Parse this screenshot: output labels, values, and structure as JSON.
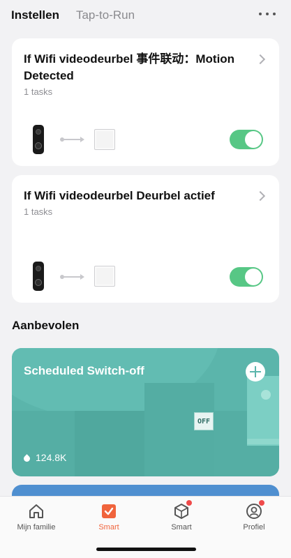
{
  "header": {
    "tabs": [
      {
        "label": "Instellen",
        "active": true
      },
      {
        "label": "Tap-to-Run",
        "active": false
      }
    ],
    "more_icon": "more-horizontal-icon"
  },
  "automations": [
    {
      "title": "If Wifi videodeurbel  事件联动：Motion Detected",
      "tasks": "1 tasks",
      "enabled": true
    },
    {
      "title": "If Wifi videodeurbel  Deurbel actief",
      "tasks": "1 tasks",
      "enabled": true
    }
  ],
  "recommended": {
    "section_title": "Aanbevolen",
    "cards": [
      {
        "title": "Scheduled Switch-off",
        "count": "124.8K",
        "badge_text": "OFF"
      }
    ]
  },
  "colors": {
    "toggle_on": "#57c785",
    "accent": "#f0643c",
    "recommend_card": "#5bb5ab",
    "recommend_card_2": "#4f8fd0"
  },
  "tabbar": {
    "items": [
      {
        "label": "Mijn familie",
        "icon": "home-icon",
        "active": false
      },
      {
        "label": "Smart",
        "icon": "smart-check-icon",
        "active": true
      },
      {
        "label": "Smart",
        "icon": "cube-icon",
        "active": false
      },
      {
        "label": "Profiel",
        "icon": "profile-icon",
        "active": false
      }
    ]
  }
}
